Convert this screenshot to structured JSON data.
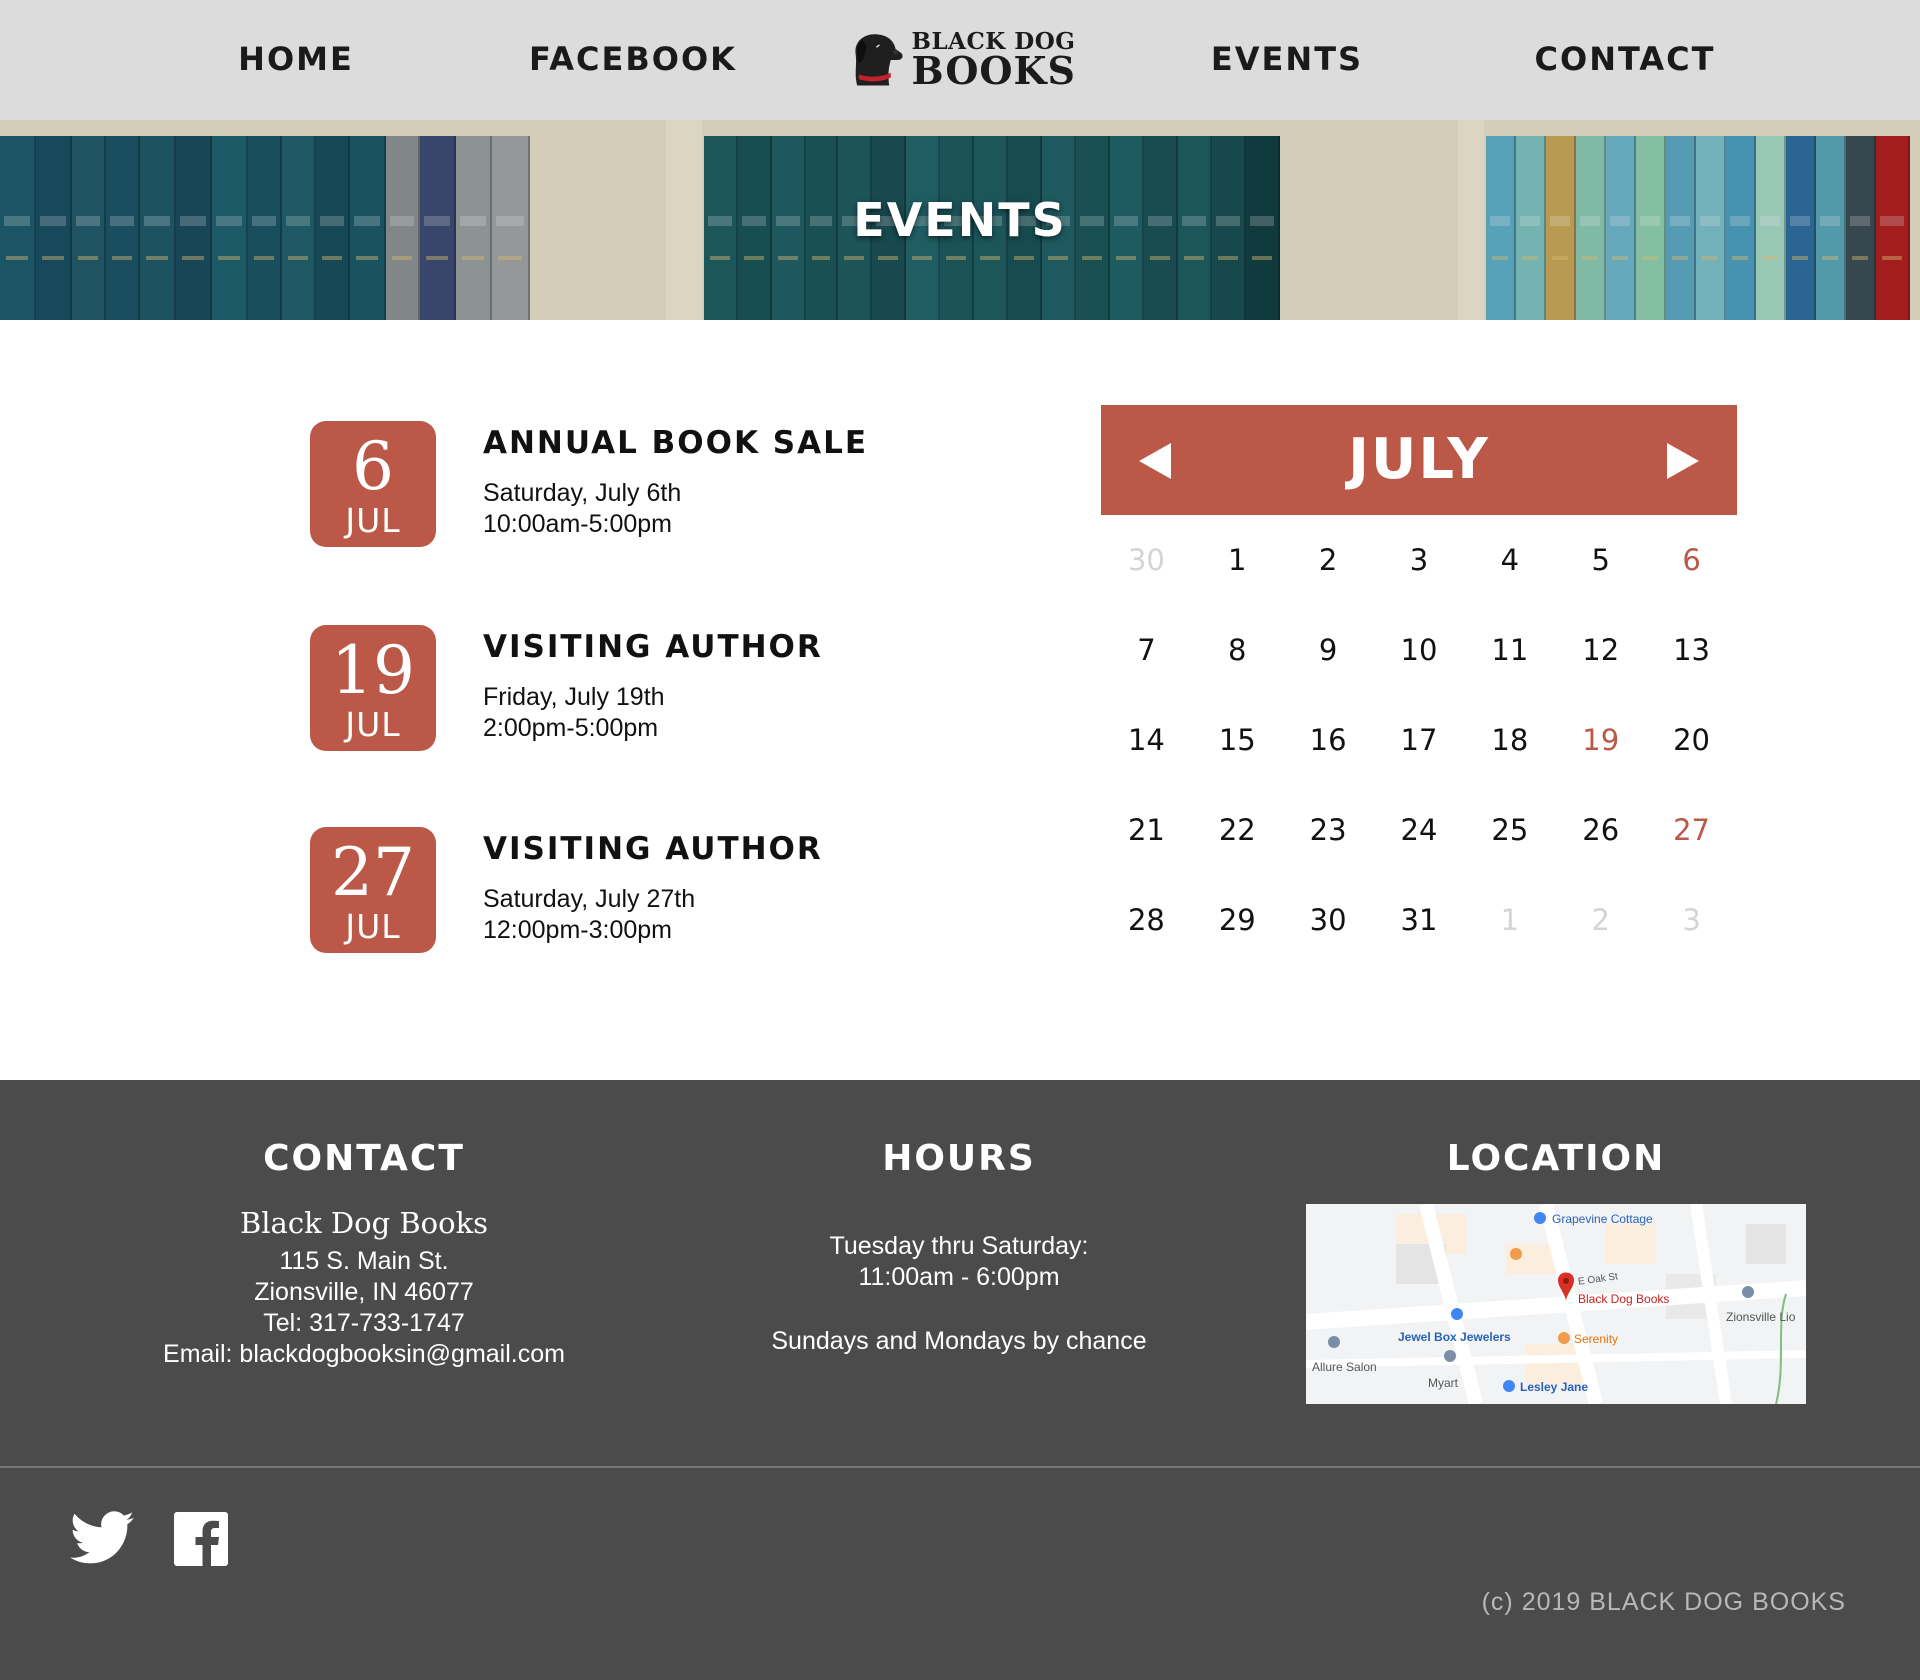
{
  "nav": {
    "items": [
      "HOME",
      "FACEBOOK",
      "EVENTS",
      "CONTACT"
    ],
    "logo_line1": "BLACK DOG",
    "logo_line2": "BOOKS"
  },
  "hero": {
    "title": "EVENTS"
  },
  "events": [
    {
      "day": "6",
      "month": "JUL",
      "title": "ANNUAL BOOK SALE",
      "date": "Saturday, July 6th",
      "time": "10:00am-5:00pm"
    },
    {
      "day": "19",
      "month": "JUL",
      "title": "VISITING AUTHOR",
      "date": "Friday, July 19th",
      "time": "2:00pm-5:00pm"
    },
    {
      "day": "27",
      "month": "JUL",
      "title": "VISITING AUTHOR",
      "date": "Saturday, July 27th",
      "time": "12:00pm-3:00pm"
    }
  ],
  "calendar": {
    "month": "JULY",
    "days": [
      {
        "d": "30",
        "muted": true
      },
      {
        "d": "1"
      },
      {
        "d": "2"
      },
      {
        "d": "3"
      },
      {
        "d": "4"
      },
      {
        "d": "5"
      },
      {
        "d": "6",
        "event": true
      },
      {
        "d": "7"
      },
      {
        "d": "8"
      },
      {
        "d": "9"
      },
      {
        "d": "10"
      },
      {
        "d": "11"
      },
      {
        "d": "12"
      },
      {
        "d": "13"
      },
      {
        "d": "14"
      },
      {
        "d": "15"
      },
      {
        "d": "16"
      },
      {
        "d": "17"
      },
      {
        "d": "18"
      },
      {
        "d": "19",
        "event": true
      },
      {
        "d": "20"
      },
      {
        "d": "21"
      },
      {
        "d": "22"
      },
      {
        "d": "23"
      },
      {
        "d": "24"
      },
      {
        "d": "25"
      },
      {
        "d": "26"
      },
      {
        "d": "27",
        "event": true
      },
      {
        "d": "28"
      },
      {
        "d": "29"
      },
      {
        "d": "30"
      },
      {
        "d": "31"
      },
      {
        "d": "1",
        "muted": true
      },
      {
        "d": "2",
        "muted": true
      },
      {
        "d": "3",
        "muted": true
      }
    ]
  },
  "footer": {
    "contact": {
      "heading": "CONTACT",
      "name": "Black Dog Books",
      "address": "115 S. Main St.",
      "city": "Zionsville, IN 46077",
      "tel": "Tel: 317-733-1747",
      "email": "Email: blackdogbooksin@gmail.com"
    },
    "hours": {
      "heading": "HOURS",
      "line1": "Tuesday thru Saturday:",
      "line2": "11:00am - 6:00pm",
      "line3": "Sundays and Mondays by chance"
    },
    "location": {
      "heading": "LOCATION",
      "map_labels": {
        "grapevine": "Grapevine Cottage",
        "street": "E Oak St",
        "store": "Black Dog Books",
        "zionsville": "Zionsville Lio",
        "jewel": "Jewel Box Jewelers",
        "serenity": "Serenity",
        "allure": "Allure Salon",
        "myart": "Myart",
        "lesley": "Lesley Jane"
      }
    },
    "copyright": "(c) 2019 BLACK DOG BOOKS"
  },
  "colors": {
    "accent": "#bb5847",
    "nav_bg": "#dcdcdc",
    "footer_bg": "#4b4b4b"
  },
  "icons": {
    "social": [
      "twitter-icon",
      "facebook-icon"
    ],
    "logo": "black-dog-logo-icon"
  }
}
